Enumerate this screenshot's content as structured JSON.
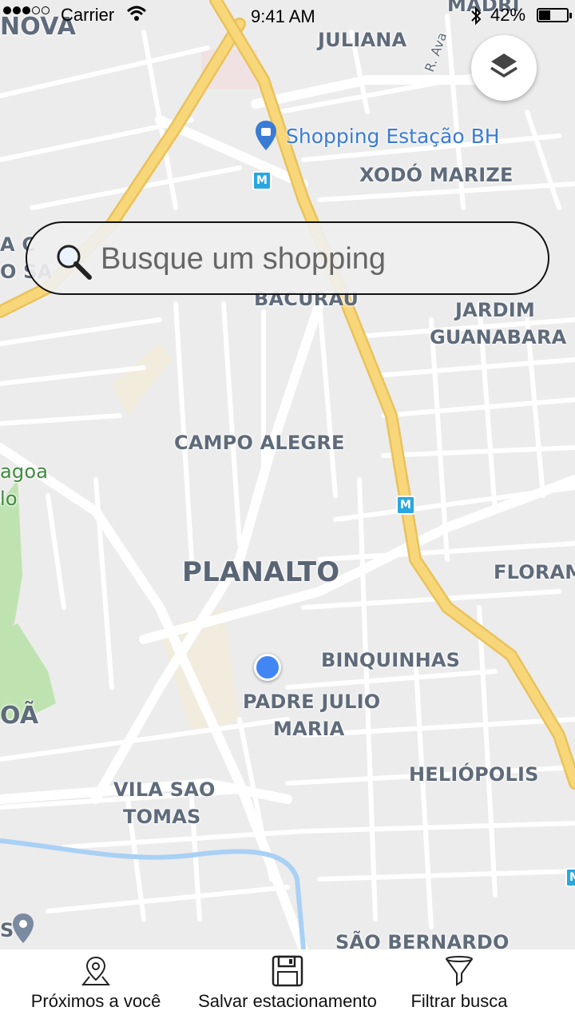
{
  "status_bar": {
    "carrier": "Carrier",
    "time": "9:41 AM",
    "battery_percent": "42%",
    "battery_level": 0.42,
    "signal_dots_filled": 3,
    "signal_dots_total": 5
  },
  "search": {
    "placeholder": "Busque um shopping"
  },
  "map": {
    "poi": "Shopping Estação BH",
    "metro_symbol": "M",
    "labels": {
      "nova": "NOVA",
      "madri": "MADRI",
      "juliana": "JULIANA",
      "rua_ava": "R. Ava",
      "xodo_marize": "XODÓ MARIZE",
      "acs": "A C",
      "osa": "O SA",
      "bacurau": "BACURAU",
      "jardim_guanabara_1": "JARDIM",
      "jardim_guanabara_2": "GUANABARA",
      "campo_alegre": "CAMPO ALEGRE",
      "agoa": "agoa",
      "lo": "lo",
      "planalto": "PLANALTO",
      "floram": "FLORAM",
      "binquinhas": "BINQUINHAS",
      "padre_julio_1": "PADRE JULIO",
      "padre_julio_2": "MARIA",
      "oa": "OÃ",
      "heliopolis": "HELIÓPOLIS",
      "vila_sao_tomas_1": "VILA SAO",
      "vila_sao_tomas_2": "TOMAS",
      "s": "S",
      "sao_bernardo": "SÃO BERNARDO"
    }
  },
  "tabs": [
    {
      "label": "Próximos a você",
      "icon": "map-pin-icon"
    },
    {
      "label": "Salvar estacionamento",
      "icon": "floppy-disk-icon"
    },
    {
      "label": "Filtrar busca",
      "icon": "funnel-icon"
    }
  ],
  "colors": {
    "highway": "#f8d77a",
    "highway_edge": "#e9c25a",
    "road": "#ffffff",
    "map_bg": "#ececec",
    "park": "#bfe3b0",
    "water": "#a9d0f5",
    "user_dot": "#4285f4",
    "poi_blue": "#3a7bd5"
  }
}
